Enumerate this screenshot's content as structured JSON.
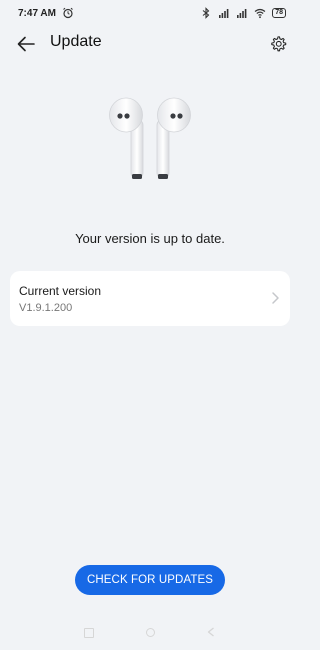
{
  "status_bar": {
    "time": "7:47 AM",
    "battery": "78",
    "icons": [
      "alarm-icon",
      "bluetooth-icon",
      "signal-icon",
      "signal-icon",
      "wifi-icon",
      "battery-icon"
    ]
  },
  "header": {
    "title": "Update",
    "back_icon": "back-arrow-icon",
    "settings_icon": "gear-icon"
  },
  "device_image": "earbuds",
  "status_message": "Your version is up to date.",
  "version_card": {
    "label": "Current version",
    "value": "V1.9.1.200"
  },
  "check_button_label": "CHECK FOR UPDATES",
  "colors": {
    "accent": "#1769e6",
    "background": "#f1f3f6",
    "card": "#ffffff"
  }
}
